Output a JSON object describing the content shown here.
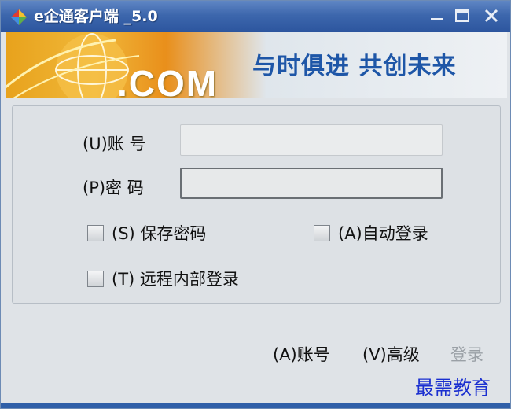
{
  "window": {
    "title": "e企通客户端 _5.0",
    "controls": {
      "minimize": "minimize-icon",
      "maximize": "maximize-icon",
      "close": "close-icon"
    }
  },
  "banner": {
    "logo_text": ".COM",
    "slogan": "与时俱进 共创未来"
  },
  "form": {
    "account_label": "(U)账 号",
    "account_value": "",
    "password_label": "(P)密 码",
    "password_value": "",
    "save_password": {
      "label": "(S) 保存密码",
      "checked": false
    },
    "auto_login": {
      "label": "(A)自动登录",
      "checked": false
    },
    "remote_login": {
      "label": "(T) 远程内部登录",
      "checked": false
    }
  },
  "footer": {
    "account_link": "(A)账号",
    "advanced_link": "(V)高级",
    "login_button": "登录"
  },
  "watermark": "最需教育",
  "colors": {
    "titlebar": "#3d67ad",
    "slogan": "#1e56a7",
    "watermark": "#1a2fd0",
    "disabled": "#9aa0a6"
  }
}
